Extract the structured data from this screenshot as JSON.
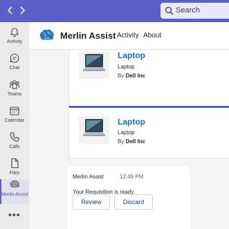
{
  "topbar": {
    "search_placeholder": "Search",
    "accent": "#5b5fc7"
  },
  "rail": {
    "items": [
      {
        "label": "Activity",
        "icon": "bell-icon"
      },
      {
        "label": "Chat",
        "icon": "chat-icon"
      },
      {
        "label": "Teams",
        "icon": "teams-icon"
      },
      {
        "label": "Calendar",
        "icon": "calendar-icon"
      },
      {
        "label": "Calls",
        "icon": "phone-icon"
      },
      {
        "label": "Files",
        "icon": "file-icon"
      },
      {
        "label": "Merlin Assist",
        "icon": "brain-icon",
        "active": true
      }
    ],
    "more": "•••"
  },
  "header": {
    "app_name": "Merlin Assist",
    "tabs": [
      "Activity",
      "About"
    ]
  },
  "cards": [
    {
      "title": "Laptop",
      "subtitle": "Laptop",
      "by_prefix": "By",
      "vendor": "Dell Inc"
    },
    {
      "title": "Laptop",
      "subtitle": "Laptop",
      "by_prefix": "By",
      "vendor": "Dell Inc"
    }
  ],
  "message": {
    "sender": "Merlin Assist",
    "time": "12:49 PM",
    "text": "Your Requisition is ready.",
    "buttons": [
      "Review",
      "Discard"
    ]
  }
}
